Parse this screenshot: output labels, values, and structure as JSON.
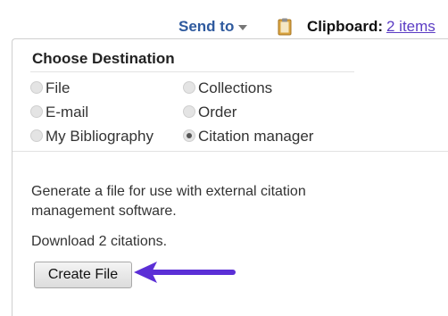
{
  "header": {
    "send_to_label": "Send to",
    "clipboard_label": "Clipboard:",
    "clipboard_link": "2 items"
  },
  "panel": {
    "title": "Choose Destination",
    "options": [
      {
        "label": "File",
        "selected": false
      },
      {
        "label": "Collections",
        "selected": false
      },
      {
        "label": "E-mail",
        "selected": false
      },
      {
        "label": "Order",
        "selected": false
      },
      {
        "label": "My Bibliography",
        "selected": false
      },
      {
        "label": "Citation manager",
        "selected": true
      }
    ],
    "description": "Generate a file for use with external citation management software.",
    "download_text": "Download 2 citations.",
    "create_button_label": "Create File"
  },
  "colors": {
    "send_to": "#2f5a9e",
    "clipboard_link": "#5b3cc4",
    "annotation_arrow": "#5b2fd6",
    "clipboard_icon": "#c9952f"
  },
  "icons": {
    "send_to_caret": "chevron-down-icon",
    "clipboard": "clipboard-icon",
    "annotation": "arrow-left-icon"
  }
}
